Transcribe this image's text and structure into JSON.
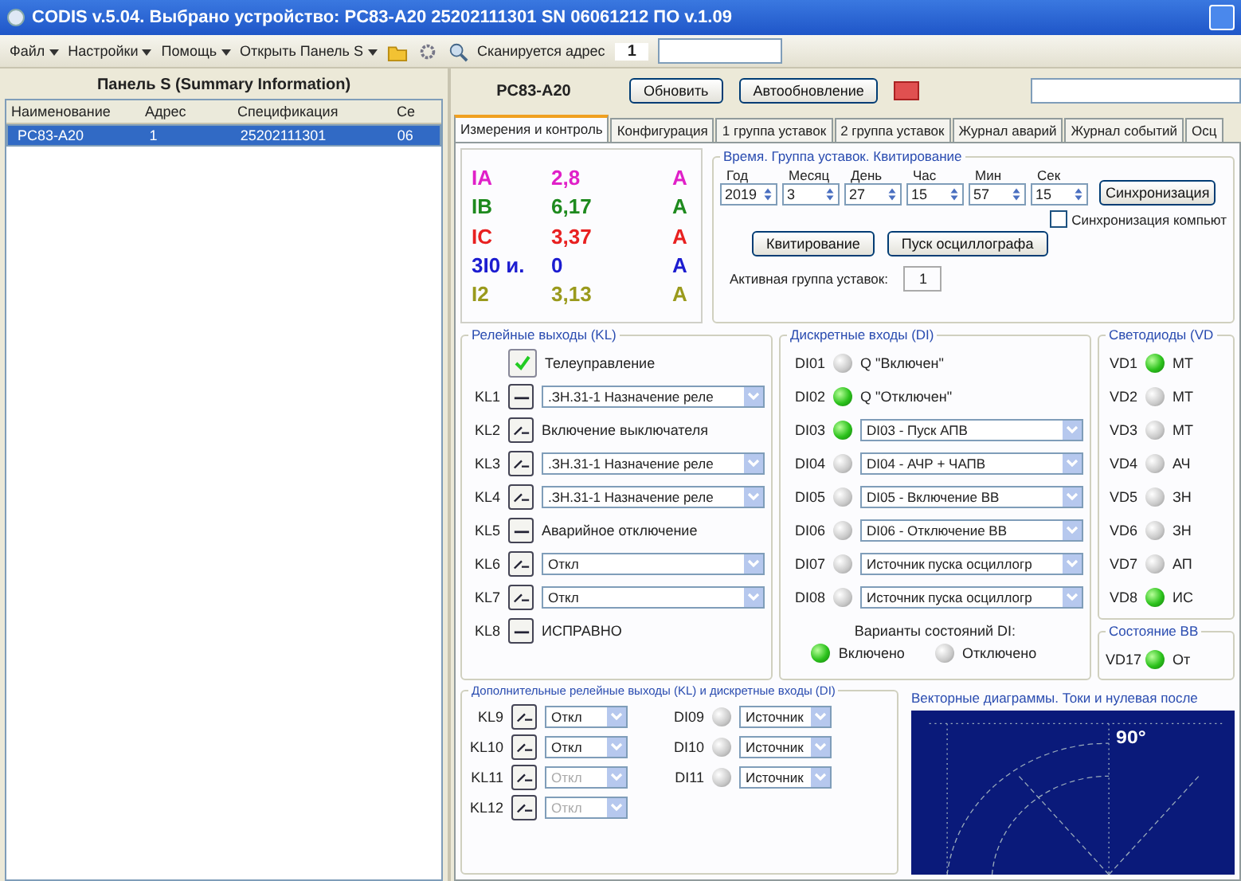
{
  "window": {
    "title": "CODIS v.5.04.  Выбрано устройство:  PC83-A20  25202111301  SN 06061212  ПО v.1.09"
  },
  "toolbar": {
    "menus": [
      "Файл",
      "Настройки",
      "Помощь"
    ],
    "open_panel": "Открыть Панель S",
    "scan_label": "Сканируется адрес",
    "scan_address": "1"
  },
  "summary_panel": {
    "title": "Панель S (Summary Information)",
    "columns": [
      "Наименование",
      "Адрес",
      "Спецификация",
      "Се"
    ],
    "rows": [
      {
        "cells": [
          "PC83-A20",
          "1",
          "25202111301",
          "06"
        ],
        "selected": true
      }
    ]
  },
  "device_bar": {
    "device": "PC83-A20",
    "refresh": "Обновить",
    "auto_refresh": "Автообновление"
  },
  "tabs": [
    {
      "label": "Измерения и контроль",
      "selected": true
    },
    {
      "label": "Конфигурация",
      "selected": false
    },
    {
      "label": "1 группа уставок",
      "selected": false
    },
    {
      "label": "2 группа уставок",
      "selected": false
    },
    {
      "label": "Журнал аварий",
      "selected": false
    },
    {
      "label": "Журнал событий",
      "selected": false
    },
    {
      "label": "Осц",
      "selected": false
    }
  ],
  "measurements": [
    {
      "name": "IA",
      "value": "2,8",
      "unit": "A",
      "color": "#e020c8"
    },
    {
      "name": "IB",
      "value": "6,17",
      "unit": "A",
      "color": "#1e8a1e"
    },
    {
      "name": "IC",
      "value": "3,37",
      "unit": "A",
      "color": "#e82020"
    },
    {
      "name": "3I0 и.",
      "value": "0",
      "unit": "A",
      "color": "#1c1cd0"
    },
    {
      "name": "I2",
      "value": "3,13",
      "unit": "A",
      "color": "#9a9a1c"
    }
  ],
  "time_group": {
    "title": "Время. Группа уставок. Квитирование",
    "fields": [
      {
        "label": "Год",
        "value": "2019"
      },
      {
        "label": "Месяц",
        "value": "3"
      },
      {
        "label": "День",
        "value": "27"
      },
      {
        "label": "Час",
        "value": "15"
      },
      {
        "label": "Мин",
        "value": "57"
      },
      {
        "label": "Сек",
        "value": "15"
      }
    ],
    "sync_button": "Синхронизация",
    "sync_pc": {
      "label": "Синхронизация компьют",
      "checked": false
    },
    "ack_button": "Квитирование",
    "osc_button": "Пуск осциллографа",
    "active_group_label": "Активная группа уставок:",
    "active_group": "1"
  },
  "relays": {
    "title": "Релейные выходы (KL)",
    "telecontrol": {
      "label": "Телеуправление",
      "checked": true
    },
    "items": [
      {
        "name": "KL1",
        "closed": false,
        "kind": "select",
        "text": ".ЗН.31-1 Назначение реле"
      },
      {
        "name": "KL2",
        "closed": true,
        "kind": "text",
        "text": "Включение выключателя"
      },
      {
        "name": "KL3",
        "closed": true,
        "kind": "select",
        "text": ".ЗН.31-1 Назначение реле"
      },
      {
        "name": "KL4",
        "closed": true,
        "kind": "select",
        "text": ".ЗН.31-1 Назначение реле"
      },
      {
        "name": "KL5",
        "closed": false,
        "kind": "text",
        "text": "Аварийное отключение"
      },
      {
        "name": "KL6",
        "closed": true,
        "kind": "select",
        "text": "Откл"
      },
      {
        "name": "KL7",
        "closed": true,
        "kind": "select",
        "text": "Откл"
      },
      {
        "name": "KL8",
        "closed": false,
        "kind": "text",
        "text": "ИСПРАВНО"
      }
    ]
  },
  "inputs": {
    "title": "Дискретные входы (DI)",
    "items": [
      {
        "name": "DI01",
        "on": false,
        "kind": "text",
        "text": "Q \"Включен\""
      },
      {
        "name": "DI02",
        "on": true,
        "kind": "text",
        "text": "Q \"Отключен\""
      },
      {
        "name": "DI03",
        "on": true,
        "kind": "select",
        "text": "DI03 - Пуск АПВ"
      },
      {
        "name": "DI04",
        "on": false,
        "kind": "select",
        "text": "DI04 - АЧР + ЧАПВ"
      },
      {
        "name": "DI05",
        "on": false,
        "kind": "select",
        "text": "DI05 - Включение ВВ"
      },
      {
        "name": "DI06",
        "on": false,
        "kind": "select",
        "text": "DI06 - Отключение ВВ"
      },
      {
        "name": "DI07",
        "on": false,
        "kind": "select",
        "text": "Источник пуска осциллогр"
      },
      {
        "name": "DI08",
        "on": false,
        "kind": "select",
        "text": "Источник пуска осциллогр"
      }
    ],
    "legend_title": "Варианты состояний DI:",
    "legend": [
      {
        "label": "Включено",
        "on": true
      },
      {
        "label": "Отключено",
        "on": false
      }
    ]
  },
  "leds": {
    "title": "Светодиоды (VD",
    "items": [
      {
        "name": "VD1",
        "on": true,
        "text": "МТ"
      },
      {
        "name": "VD2",
        "on": false,
        "text": "МТ"
      },
      {
        "name": "VD3",
        "on": false,
        "text": "МТ"
      },
      {
        "name": "VD4",
        "on": false,
        "text": "АЧ"
      },
      {
        "name": "VD5",
        "on": false,
        "text": "ЗН"
      },
      {
        "name": "VD6",
        "on": false,
        "text": "ЗН"
      },
      {
        "name": "VD7",
        "on": false,
        "text": "АП"
      },
      {
        "name": "VD8",
        "on": true,
        "text": "ИС"
      }
    ],
    "breaker_title": "Состояние ВВ",
    "breaker": {
      "name": "VD17",
      "on": true,
      "text": "От"
    }
  },
  "extra": {
    "title": "Дополнительные релейные выходы (KL) и дискретные входы (DI)",
    "relays": [
      {
        "name": "KL9",
        "closed": true,
        "value": "Откл",
        "disabled": false
      },
      {
        "name": "KL10",
        "closed": true,
        "value": "Откл",
        "disabled": false
      },
      {
        "name": "KL11",
        "closed": true,
        "value": "Откл",
        "disabled": true
      },
      {
        "name": "KL12",
        "closed": true,
        "value": "Откл",
        "disabled": true
      }
    ],
    "inputs": [
      {
        "name": "DI09",
        "on": false,
        "value": "Источник"
      },
      {
        "name": "DI10",
        "on": false,
        "value": "Источник"
      },
      {
        "name": "DI11",
        "on": false,
        "value": "Источник"
      }
    ]
  },
  "vector": {
    "title": "Векторные диаграммы.  Токи и нулевая после",
    "angle_label": "90°"
  }
}
